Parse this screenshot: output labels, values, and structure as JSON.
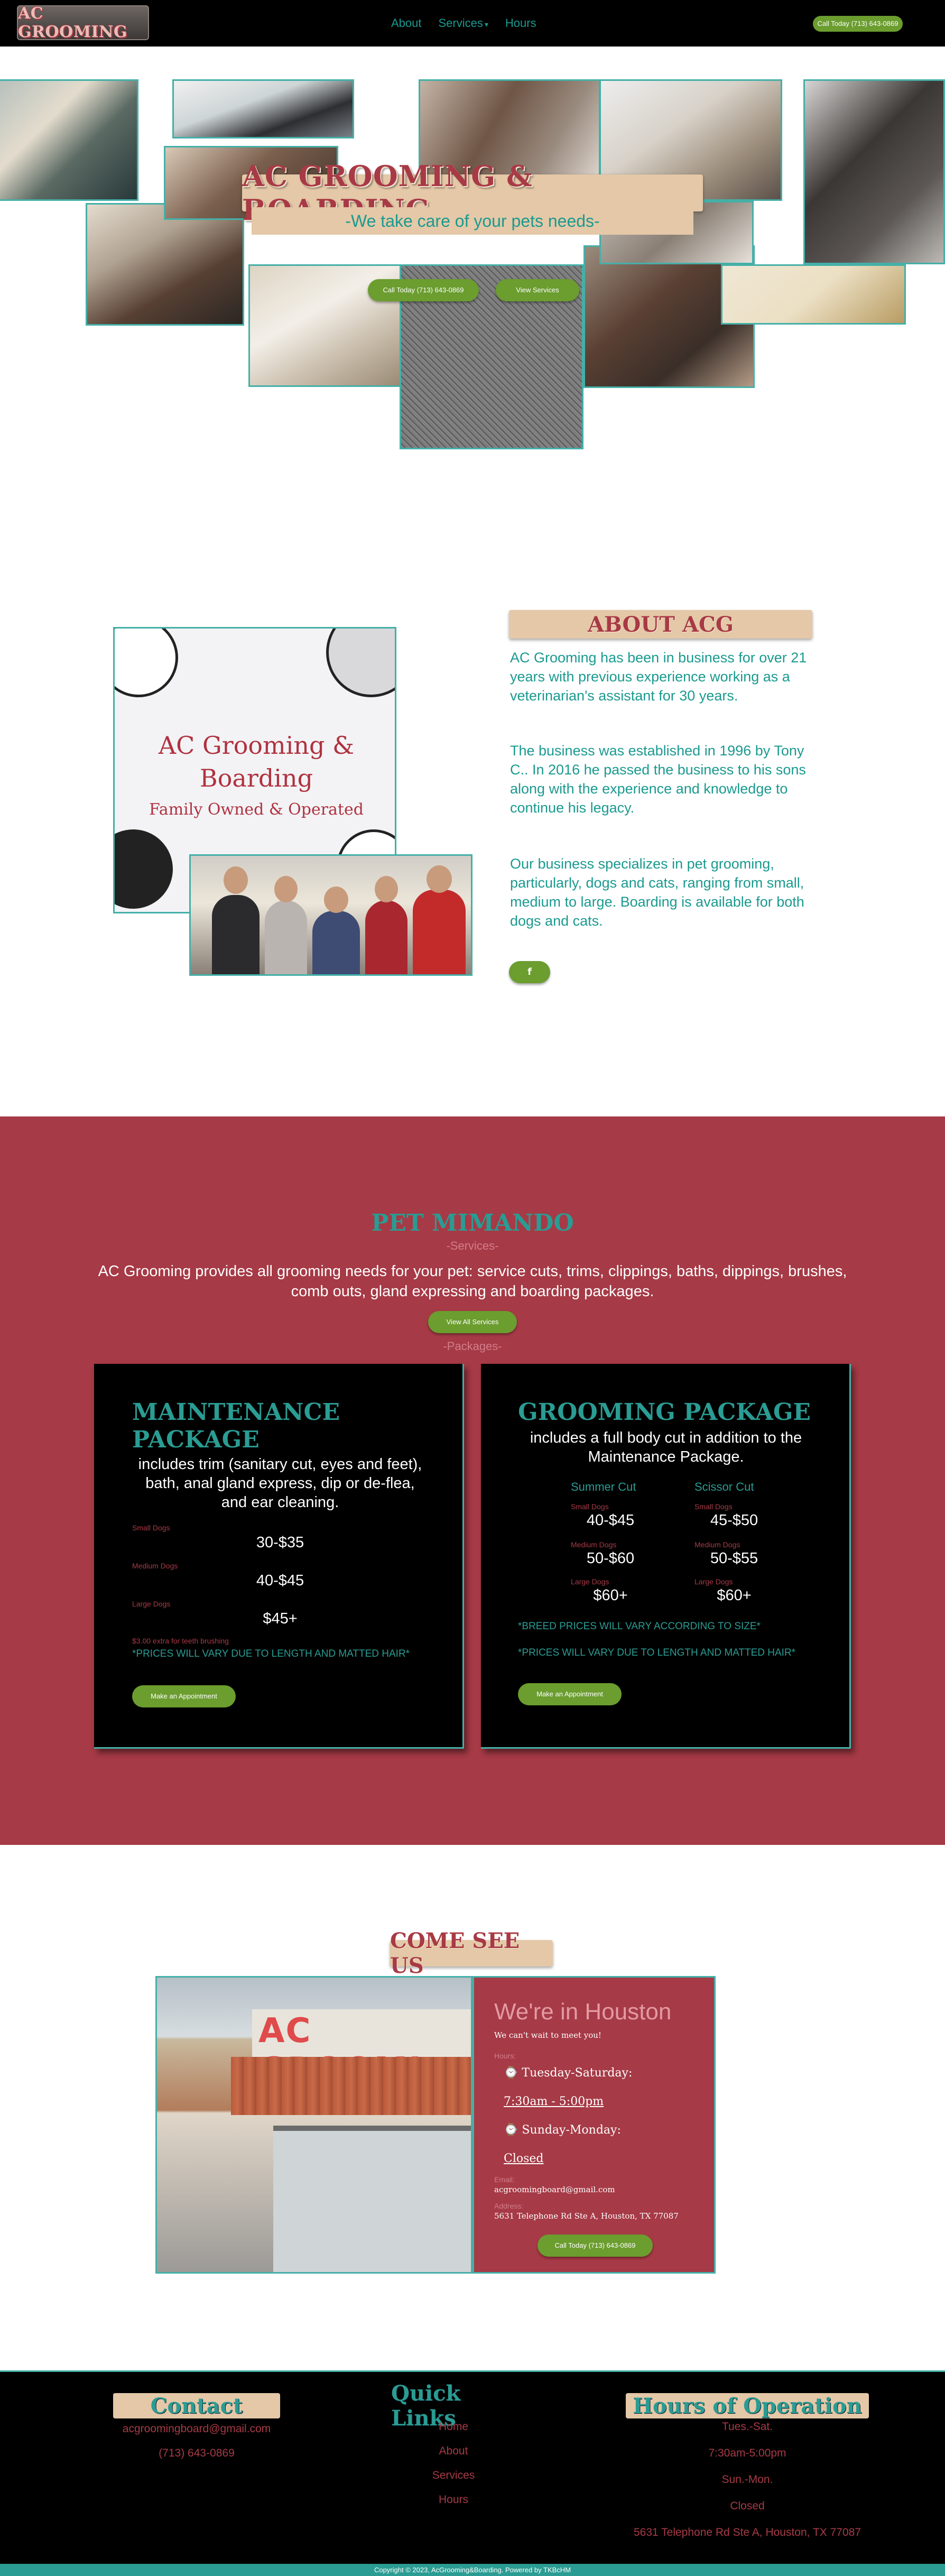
{
  "nav": {
    "logo_text": "AC GROOMING",
    "links": [
      "About",
      "Services",
      "Hours"
    ],
    "services_caret": "▾",
    "cta": "Call Today (713) 643-0869"
  },
  "hero": {
    "title": "AC GROOMING & BOARDING",
    "subtitle": "-We take care of your pets needs-",
    "call_button": "Call Today (713) 643-0869",
    "services_button": "View Services"
  },
  "about": {
    "art_title": "AC Grooming & Boarding",
    "art_subtitle": "Family Owned & Operated",
    "title": "ABOUT ACG",
    "p1": "AC Grooming has been in business for over 21 years with previous experience working as a veterinarian's assistant for 30 years.",
    "p2": "The business was established in 1996 by Tony C.. In 2016 he passed the business to his sons along with the experience and knowledge to continue his legacy.",
    "p3": "Our business specializes in pet grooming, particularly, dogs and cats, ranging from small, medium to large. Boarding is available for both dogs and cats.",
    "facebook_button": "f"
  },
  "services": {
    "title": "PET MIMANDO",
    "subtitle": "-Services-",
    "description": "AC Grooming provides all grooming needs for your pet: service cuts, trims, clippings, baths, dippings, brushes, comb outs, gland expressing and boarding packages.",
    "view_all_button": "View All Services",
    "packages_label": "-Packages-",
    "maintenance": {
      "title": "MAINTENANCE PACKAGE",
      "description": "includes trim (sanitary cut, eyes and feet), bath, anal gland express, dip or de-flea, and ear cleaning.",
      "sizes": [
        {
          "label": "Small Dogs",
          "price": "30-$35"
        },
        {
          "label": "Medium Dogs",
          "price": "40-$45"
        },
        {
          "label": "Large Dogs",
          "price": "$45+"
        }
      ],
      "extra": "$3.00 extra for teeth brushing",
      "note": "*PRICES WILL VARY DUE TO LENGTH AND MATTED HAIR*",
      "button": "Make an Appointment"
    },
    "grooming": {
      "title": "GROOMING PACKAGE",
      "description": "includes a full body cut in addition to the Maintenance Package.",
      "col1_head": "Summer Cut",
      "col2_head": "Scissor Cut",
      "summer": [
        {
          "label": "Small Dogs",
          "price": "40-$45"
        },
        {
          "label": "Medium Dogs",
          "price": "50-$60"
        },
        {
          "label": "Large Dogs",
          "price": "$60+"
        }
      ],
      "scissor": [
        {
          "label": "Small Dogs",
          "price": "45-$50"
        },
        {
          "label": "Medium Dogs",
          "price": "50-$55"
        },
        {
          "label": "Large Dogs",
          "price": "$60+"
        }
      ],
      "note1": "*BREED PRICES WILL VARY ACCORDING TO SIZE*",
      "note2": "*PRICES WILL VARY DUE TO LENGTH AND MATTED HAIR*",
      "button": "Make an Appointment"
    }
  },
  "contact_section": {
    "title": "COME SEE US",
    "store_sign": "AC GROOMI",
    "heading": "We're in Houston",
    "tagline": "We can't wait to meet you!",
    "hours_label": "Hours:",
    "hours": [
      {
        "day": "Tuesday-Saturday:",
        "time": "7:30am - 5:00pm"
      },
      {
        "day": "Sunday-Monday:",
        "time": "Closed"
      }
    ],
    "email_label": "Email:",
    "email": "acgroomingboard@gmail.com",
    "address_label": "Address:",
    "address": "5631 Telephone Rd Ste A, Houston, TX 77087",
    "call_button": "Call Today (713) 643-0869"
  },
  "footer": {
    "contact_title": "Contact",
    "email": "acgroomingboard@gmail.com",
    "phone": "(713) 643-0869",
    "links_title": "Quick Links",
    "links": [
      "Home",
      "About",
      "Services",
      "Hours"
    ],
    "hours_title": "Hours of Operation",
    "hours": [
      "Tues.-Sat.",
      "7:30am-5:00pm",
      "Sun.-Mon.",
      "Closed"
    ],
    "address": "5631 Telephone Rd Ste A, Houston, TX 77087",
    "copyright": "Copyright © 2023, AcGrooming&Boarding. Powered by TKBcHM"
  },
  "colors": {
    "brand_red": "#a63a46",
    "teal": "#2a9c93",
    "tan": "#e4c8a7",
    "green_button": "#6b9d2f"
  }
}
